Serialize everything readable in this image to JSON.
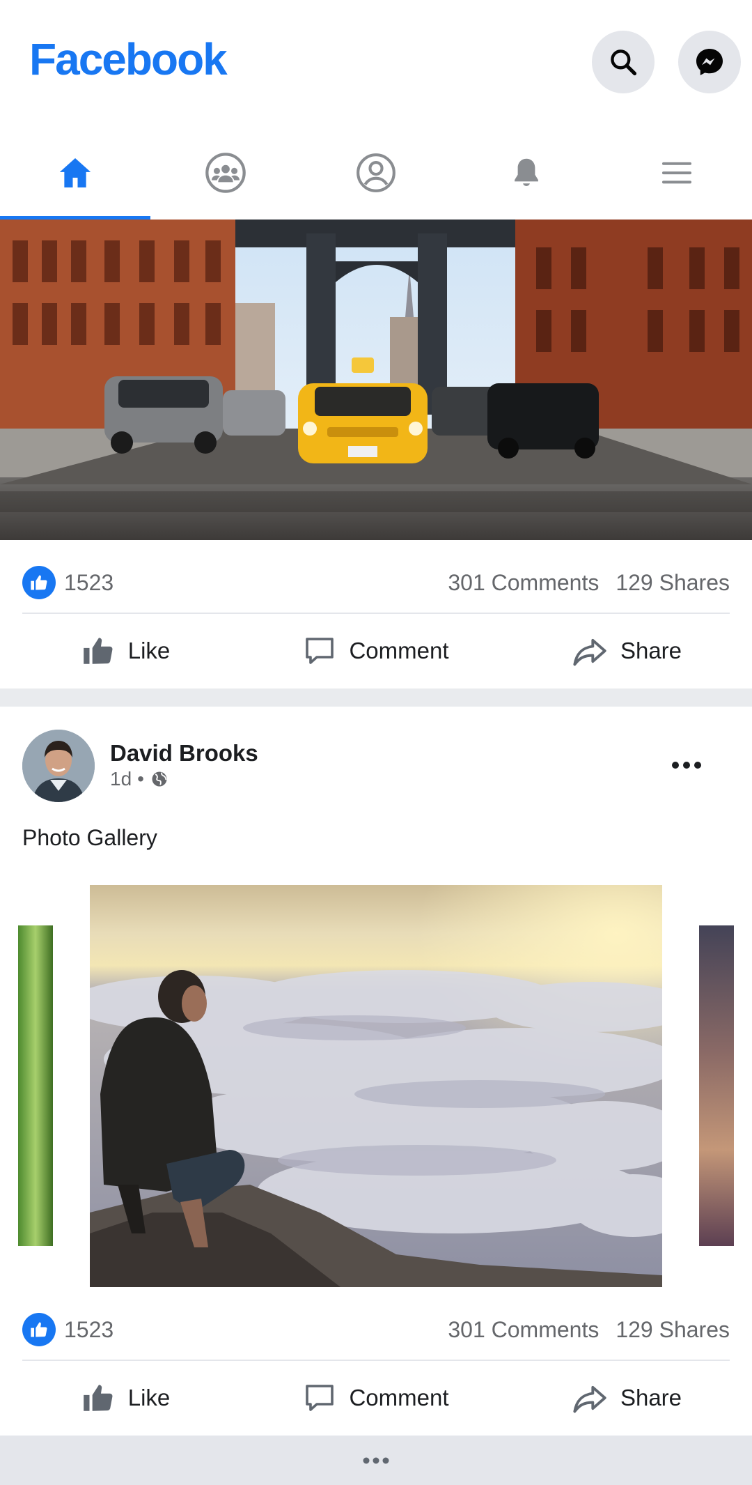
{
  "header": {
    "brand": "Facebook",
    "search_icon": "search-icon",
    "messenger_icon": "messenger-icon"
  },
  "nav": {
    "tabs": [
      {
        "icon": "home-icon",
        "active": true
      },
      {
        "icon": "groups-icon",
        "active": false
      },
      {
        "icon": "profile-icon",
        "active": false
      },
      {
        "icon": "bell-icon",
        "active": false
      },
      {
        "icon": "menu-icon",
        "active": false
      }
    ]
  },
  "posts": [
    {
      "image": "city-street-taxi-image",
      "likes": "1523",
      "comments": "301 Comments",
      "shares": "129 Shares",
      "actions": {
        "like": "Like",
        "comment": "Comment",
        "share": "Share"
      }
    },
    {
      "author": "David Brooks",
      "time": "1d",
      "separator": "•",
      "text": "Photo Gallery",
      "image": "man-above-clouds-image",
      "likes": "1523",
      "comments": "301 Comments",
      "shares": "129 Shares",
      "actions": {
        "like": "Like",
        "comment": "Comment",
        "share": "Share"
      }
    }
  ],
  "colors": {
    "brand": "#1877f2",
    "secondary_text": "#65676b",
    "divider": "#e4e6eb",
    "band": "#e9ebee"
  }
}
